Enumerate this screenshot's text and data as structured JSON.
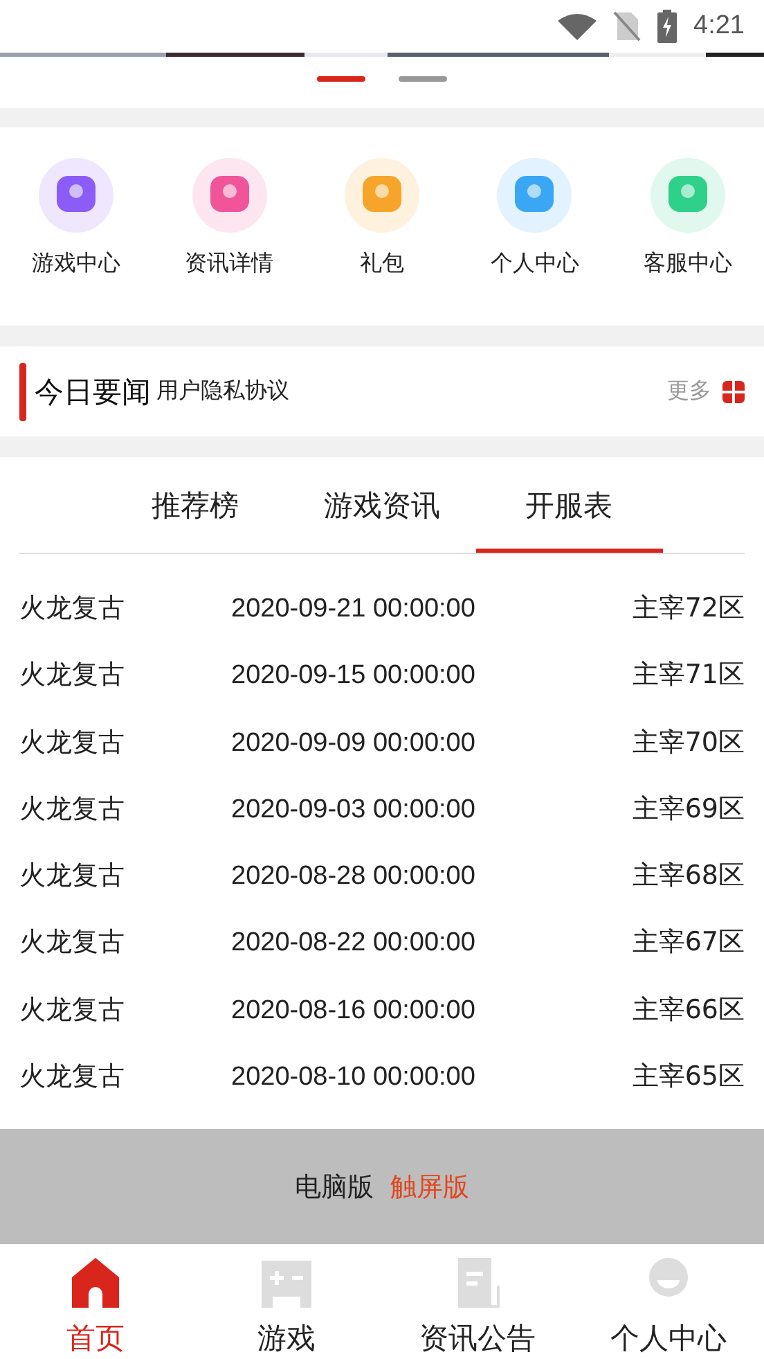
{
  "status_bar": {
    "time": "4:21"
  },
  "banner": {
    "kind": "picture",
    "dots": [
      {
        "selected": true
      },
      {
        "selected": false
      }
    ]
  },
  "shortcuts": [
    {
      "label": "游戏中心",
      "color": "#8b5cf6"
    },
    {
      "label": "资讯详情",
      "color": "#f0559a"
    },
    {
      "label": "礼包",
      "color": "#f7a52a"
    },
    {
      "label": "个人中心",
      "color": "#3aa7f5"
    },
    {
      "label": "客服中心",
      "color": "#2fd08a"
    }
  ],
  "news": {
    "title": "今日要闻",
    "headline": "用户隐私协议",
    "more": "更多"
  },
  "tabs": [
    {
      "label": "推荐榜",
      "selected": false
    },
    {
      "label": "游戏资讯",
      "selected": false
    },
    {
      "label": "开服表",
      "selected": true
    }
  ],
  "servers": [
    {
      "game": "火龙复古",
      "time": "2020-09-21 00:00:00",
      "server": "主宰72区"
    },
    {
      "game": "火龙复古",
      "time": "2020-09-15 00:00:00",
      "server": "主宰71区"
    },
    {
      "game": "火龙复古",
      "time": "2020-09-09 00:00:00",
      "server": "主宰70区"
    },
    {
      "game": "火龙复古",
      "time": "2020-09-03 00:00:00",
      "server": "主宰69区"
    },
    {
      "game": "火龙复古",
      "time": "2020-08-28 00:00:00",
      "server": "主宰68区"
    },
    {
      "game": "火龙复古",
      "time": "2020-08-22 00:00:00",
      "server": "主宰67区"
    },
    {
      "game": "火龙复古",
      "time": "2020-08-16 00:00:00",
      "server": "主宰66区"
    },
    {
      "game": "火龙复古",
      "time": "2020-08-10 00:00:00",
      "server": "主宰65区"
    }
  ],
  "version_switch": [
    {
      "label": "电脑版",
      "selected": false
    },
    {
      "label": "触屏版",
      "selected": true
    }
  ],
  "bottom_nav": [
    {
      "label": "首页",
      "kind": "home",
      "selected": true
    },
    {
      "label": "游戏",
      "kind": "game",
      "selected": false
    },
    {
      "label": "资讯公告",
      "kind": "news",
      "selected": false
    },
    {
      "label": "个人中心",
      "kind": "user",
      "selected": false
    }
  ]
}
